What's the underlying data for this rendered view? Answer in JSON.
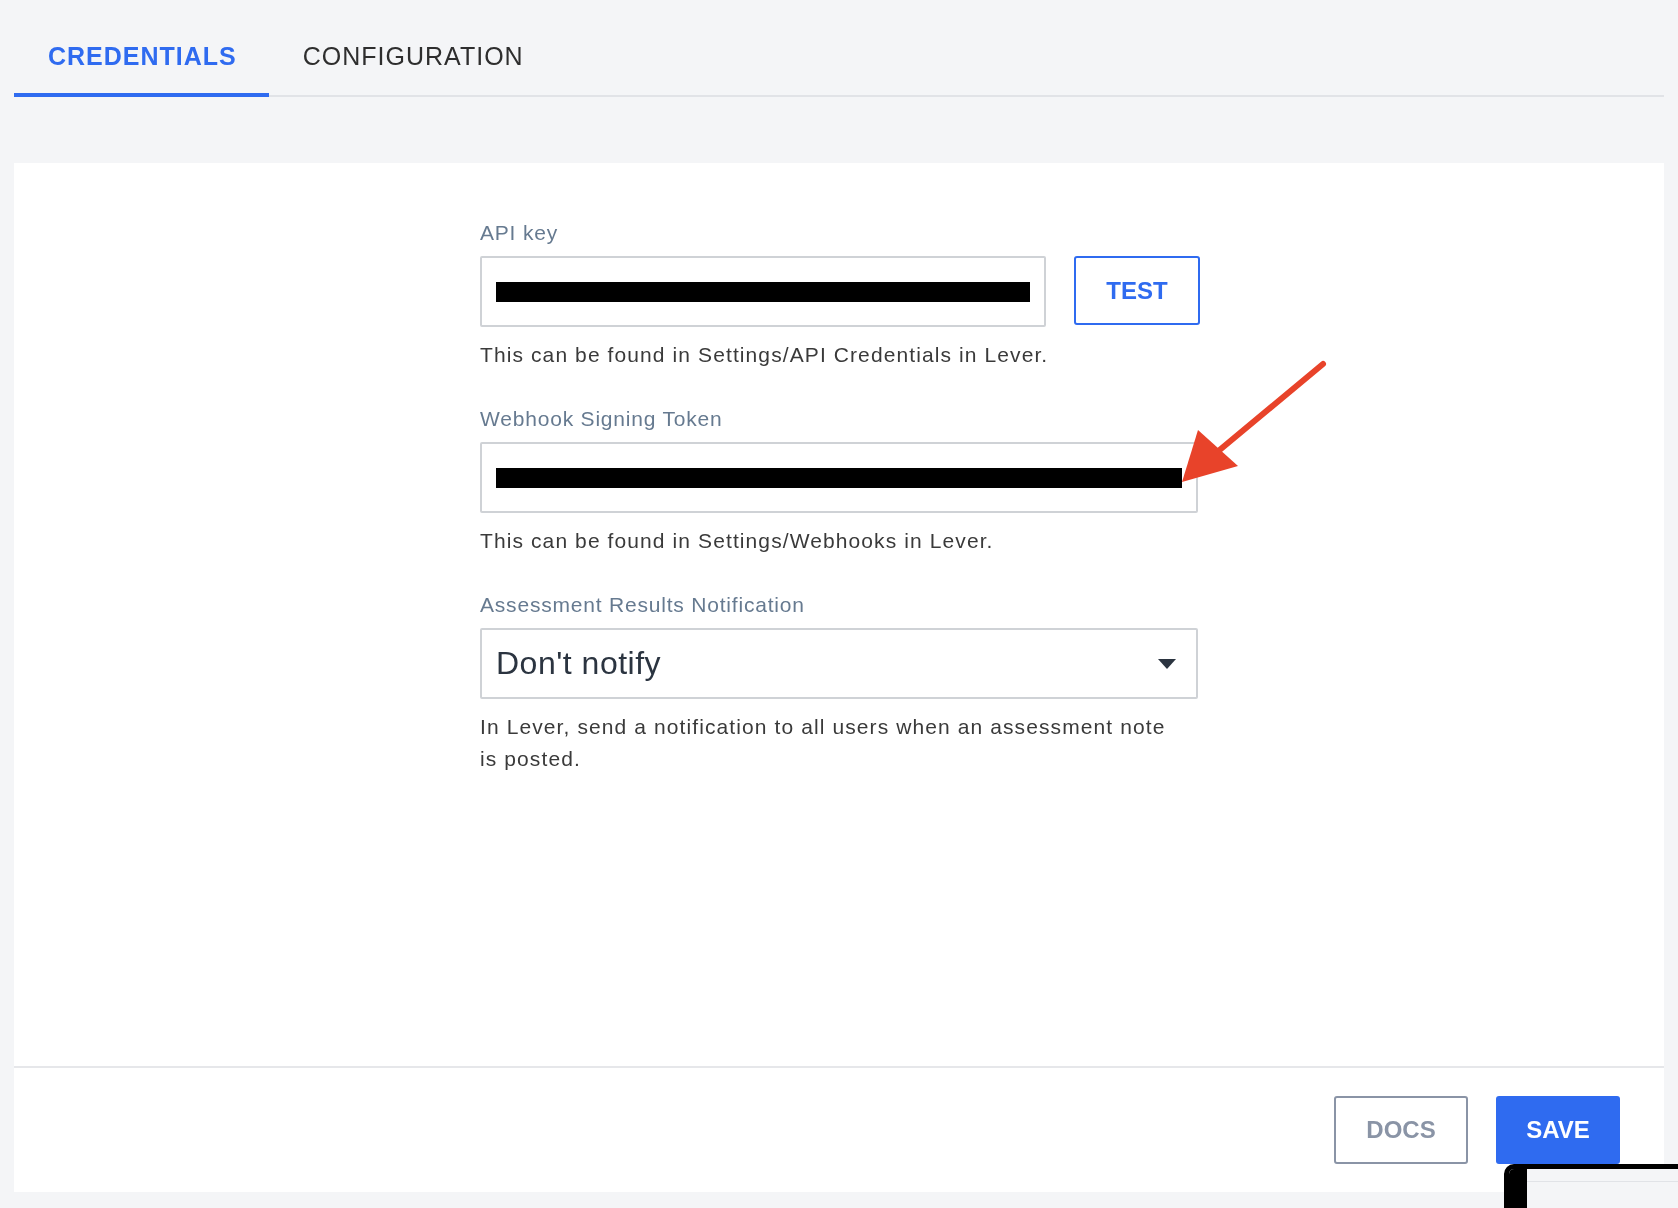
{
  "tabs": [
    {
      "label": "CREDENTIALS",
      "selected": true
    },
    {
      "label": "CONFIGURATION",
      "selected": false
    }
  ],
  "fields": [
    {
      "kind": "text",
      "label": "API key",
      "redacted": true,
      "button": "TEST",
      "help": "This can be found in Settings/API Credentials in Lever."
    },
    {
      "kind": "text",
      "label": "Webhook Signing Token",
      "redacted": true,
      "help": "This can be found in Settings/Webhooks in Lever."
    },
    {
      "kind": "select",
      "label": "Assessment Results Notification",
      "value": "Don't notify",
      "help": "In Lever, send a notification to all users when an assessment note is posted."
    }
  ],
  "footer": {
    "buttons": [
      {
        "label": "DOCS",
        "kind": "secondary"
      },
      {
        "label": "SAVE",
        "kind": "primary"
      }
    ]
  }
}
